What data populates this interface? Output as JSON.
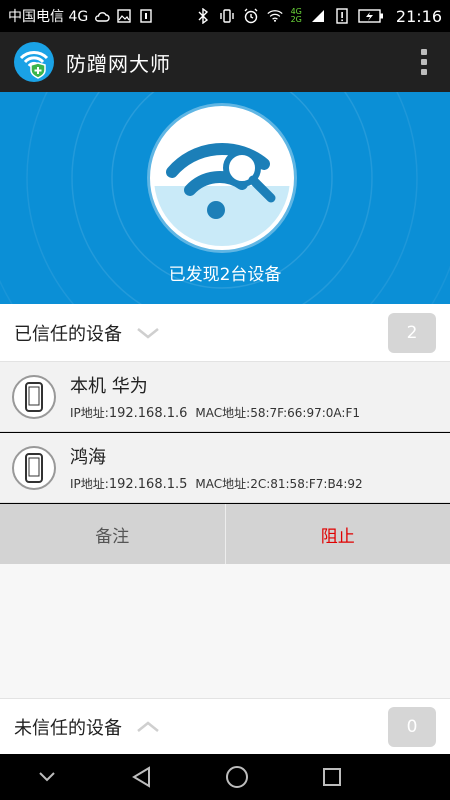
{
  "status_bar": {
    "carrier": "中国电信 4G",
    "network_badge_top": "4G",
    "network_badge_bottom": "2G",
    "time": "21:16"
  },
  "app": {
    "title": "防蹭网大师"
  },
  "hero": {
    "status_text": "已发现2台设备"
  },
  "trusted_section": {
    "title": "已信任的设备",
    "count": "2",
    "devices": [
      {
        "name": "本机 华为",
        "ip_label": "IP地址:",
        "ip": "192.168.1.6",
        "mac_label": "MAC地址:",
        "mac": "58:7F:66:97:0A:F1"
      },
      {
        "name": "鸿海",
        "ip_label": "IP地址:",
        "ip": "192.168.1.5",
        "mac_label": "MAC地址:",
        "mac": "2C:81:58:F7:B4:92"
      }
    ]
  },
  "actions": {
    "note_label": "备注",
    "block_label": "阻止"
  },
  "untrusted_section": {
    "title": "未信任的设备",
    "count": "0"
  },
  "colors": {
    "hero_blue": "#0b8fd6",
    "block_red": "#e00000",
    "app_bar": "#212121"
  },
  "icons": {
    "app_logo": "wifi-shield-icon",
    "hero": "wifi-search-icon",
    "device": "phone-icon",
    "trusted_chevron": "chevron-down-icon",
    "untrusted_chevron": "chevron-up-icon"
  }
}
